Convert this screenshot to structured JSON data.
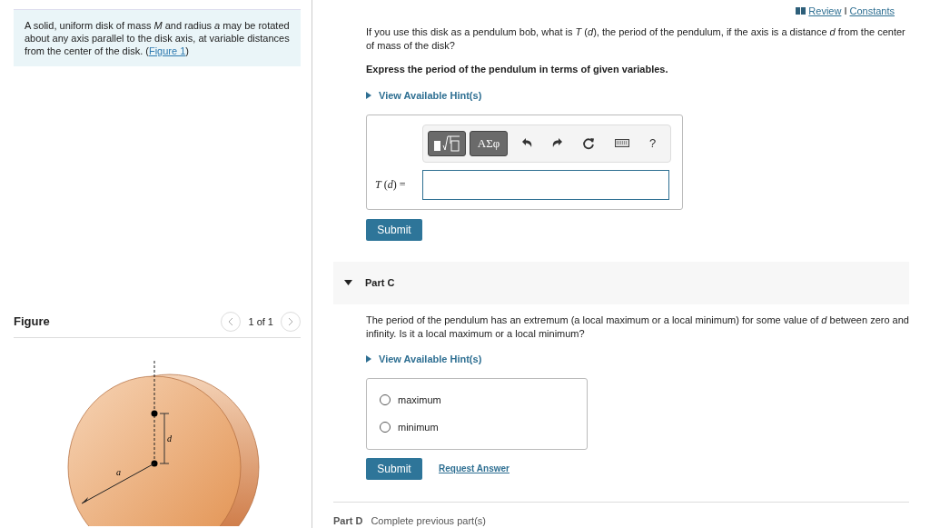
{
  "intro": {
    "text": "A solid, uniform disk of mass *M* and radius *a* may be rotated about any axis parallel to the disk axis, at variable distances from the center of the disk. (",
    "link": "Figure 1",
    "after": ")"
  },
  "figure": {
    "title": "Figure",
    "pager": "1 of 1",
    "labels": {
      "d": "d",
      "a": "a"
    }
  },
  "top_links": {
    "review": "Review",
    "separator": "I",
    "constants": "Constants"
  },
  "part_b": {
    "question": "If you use this disk as a pendulum bob, what is *T* (*d*), the period of the pendulum, if the axis is a distance *d* from the center of mass of the disk?",
    "instruction": "Express the period of the pendulum in terms of given variables.",
    "hint": "View Available Hint(s)",
    "toolbar": {
      "greek": "ΑΣφ",
      "help": "?"
    },
    "answer_label": "*T* (*d*) =",
    "submit": "Submit"
  },
  "part_c": {
    "title": "Part C",
    "expanded": true,
    "question": "The period of the pendulum has an extremum (a local maximum or a local minimum) for some value of *d* between zero and infinity. Is it a local maximum or a local minimum?",
    "hint": "View Available Hint(s)",
    "options": [
      {
        "label": "maximum",
        "selected": false
      },
      {
        "label": "minimum",
        "selected": false
      }
    ],
    "submit": "Submit",
    "request": "Request Answer"
  },
  "part_d": {
    "title": "Part D",
    "status": "Complete previous part(s)"
  }
}
